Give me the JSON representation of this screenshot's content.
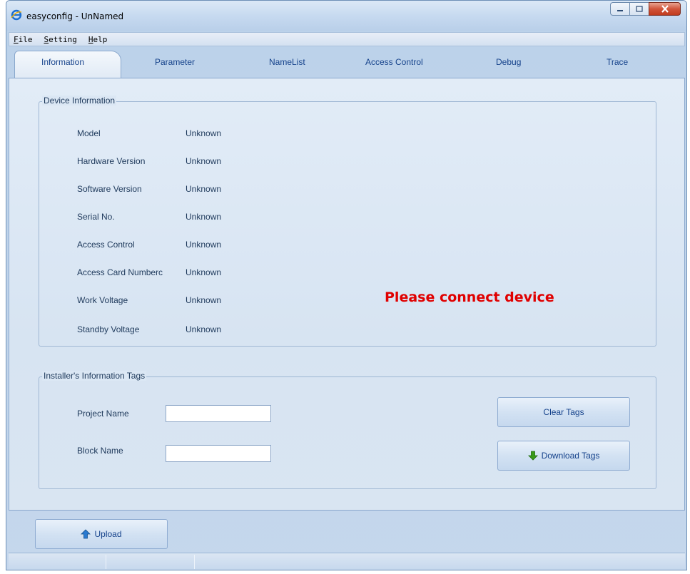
{
  "window": {
    "title": "easyconfig - UnNamed"
  },
  "menu": [
    {
      "accel": "F",
      "rest": "ile"
    },
    {
      "accel": "S",
      "rest": "etting"
    },
    {
      "accel": "H",
      "rest": "elp"
    }
  ],
  "tabs": [
    "Information",
    "Parameter",
    "NameList",
    "Access Control",
    "Debug",
    "Trace"
  ],
  "device_info": {
    "title": "Device Information",
    "rows": [
      {
        "label": "Model",
        "value": "Unknown"
      },
      {
        "label": "Hardware Version",
        "value": "Unknown"
      },
      {
        "label": "Software Version",
        "value": "Unknown"
      },
      {
        "label": "Serial No.",
        "value": "Unknown"
      },
      {
        "label": "Access Control",
        "value": "Unknown"
      },
      {
        "label": "Access Card Numberc",
        "value": "Unknown"
      },
      {
        "label": "Work Voltage",
        "value": "Unknown"
      },
      {
        "label": "Standby Voltage",
        "value": "Unknown"
      }
    ],
    "message": "Please connect device"
  },
  "installer": {
    "title": "Installer's Information Tags",
    "project_label": "Project Name",
    "project_value": "",
    "block_label": "Block Name",
    "block_value": "",
    "clear_label": "Clear Tags",
    "download_label": "Download Tags"
  },
  "footer": {
    "upload_label": "Upload"
  },
  "colors": {
    "accent": "#15428b",
    "alert": "#e00000",
    "arrow_green": "#3a9a1a",
    "arrow_blue": "#2a7ad0"
  },
  "icons": {
    "app": "ie-logo-icon",
    "download": "green-down-arrow-icon",
    "upload": "blue-up-arrow-icon"
  }
}
